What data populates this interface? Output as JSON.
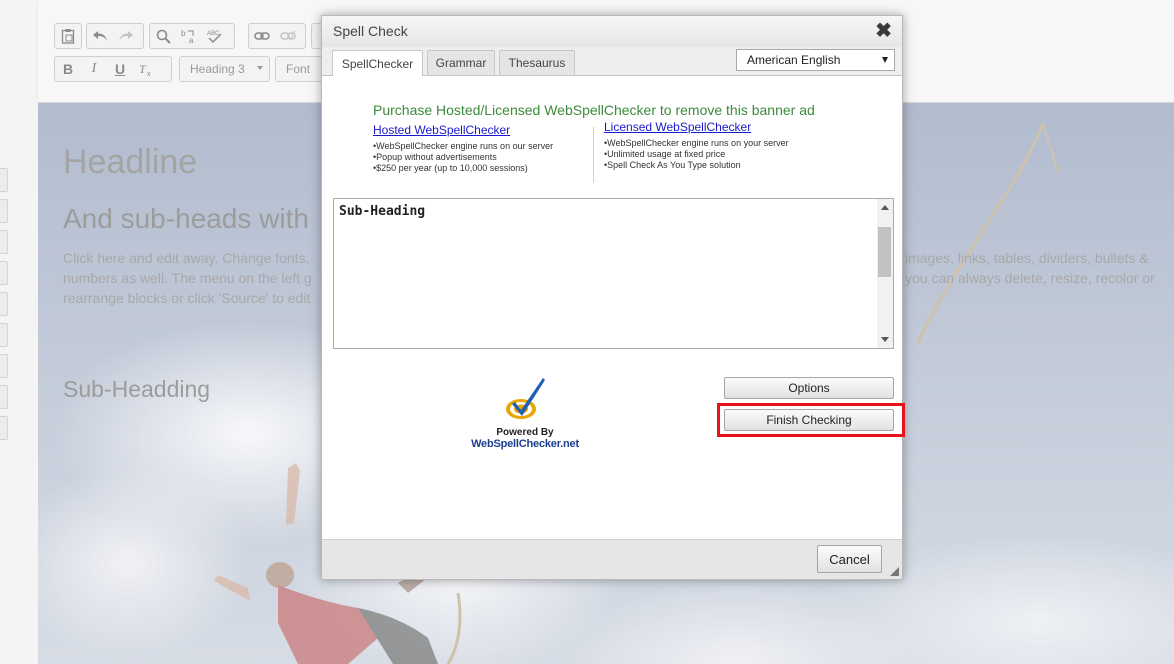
{
  "editor": {
    "toolbar": {
      "row1": [
        "paste-icon",
        "undo-icon",
        "redo-icon",
        "find-icon",
        "replace-icon",
        "spellcheck-icon",
        "link-icon",
        "unlink-icon"
      ],
      "row2": [
        "bold-icon",
        "italic-icon",
        "underline-icon",
        "remove-format-icon"
      ],
      "bold_label": "B",
      "italic_label": "I",
      "underline_label": "U",
      "format_combo": "Heading 3",
      "font_combo": "Font"
    },
    "content": {
      "headline": "Headline",
      "subhead": "And sub-heads with",
      "body_left": "Click here and edit away. Change fonts, numbers as well. The menu on the left g rearrange blocks or click 'Source' to edit",
      "body_right": "images, links, tables, dividers, bullets & you can always delete, resize, recolor or",
      "subheading2": "Sub-Headding"
    }
  },
  "dialog": {
    "title": "Spell Check",
    "close_label": "✖",
    "tabs": [
      {
        "label": "SpellChecker",
        "active": true
      },
      {
        "label": "Grammar",
        "active": false
      },
      {
        "label": "Thesaurus",
        "active": false
      }
    ],
    "language": "American English",
    "banner": {
      "headline": "Purchase Hosted/Licensed WebSpellChecker to remove this banner ad",
      "hosted": {
        "link": "Hosted WebSpellChecker",
        "bullets": [
          "WebSpellChecker engine runs on our server",
          "Popup without advertisements",
          "$250 per year (up to 10,000 sessions)"
        ]
      },
      "licensed": {
        "link": "Licensed WebSpellChecker",
        "bullets": [
          "WebSpellChecker engine runs on your server",
          "Unlimited usage at fixed price",
          "Spell Check As You Type solution"
        ]
      }
    },
    "text_content": "Sub-Heading",
    "logo": {
      "line1": "Powered By",
      "line2": "WebSpellChecker.net"
    },
    "options_button": "Options",
    "finish_button": "Finish Checking",
    "cancel_button": "Cancel",
    "colors": {
      "highlight": "#e8141b",
      "banner_green": "#3c8a3c",
      "link_blue": "#1a1acc"
    }
  }
}
